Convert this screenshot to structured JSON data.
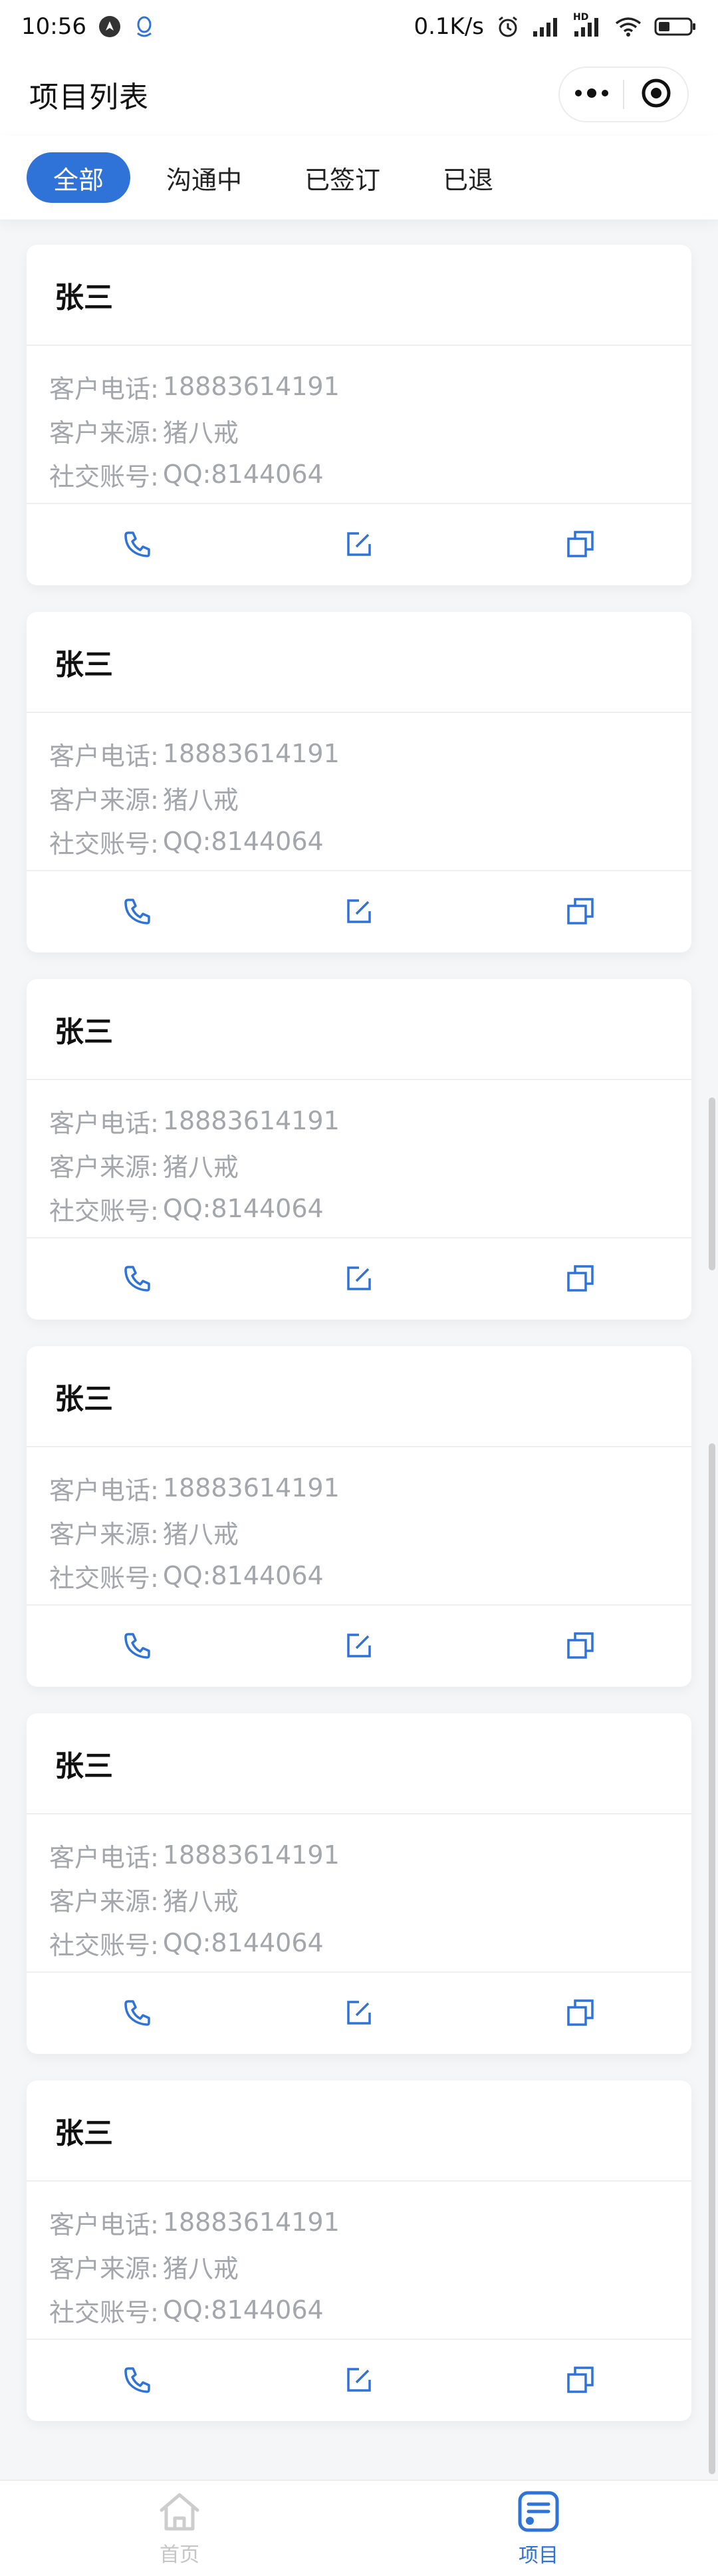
{
  "status_bar": {
    "time": "10:56",
    "net_speed": "0.1K/s",
    "hd_label": "HD",
    "icons": [
      "location-icon",
      "qq-icon",
      "alarm-icon",
      "signal-icon",
      "signal-hd-icon",
      "wifi-icon",
      "battery-icon"
    ]
  },
  "nav": {
    "title": "项目列表",
    "more_icon": "more-dots-icon",
    "close_icon": "target-circle-icon"
  },
  "tabs": [
    {
      "label": "全部",
      "active": true
    },
    {
      "label": "沟通中",
      "active": false
    },
    {
      "label": "已签订",
      "active": false
    },
    {
      "label": "已退",
      "active": false
    }
  ],
  "cards": [
    {
      "name": "张三",
      "phone_label": "客户电话:",
      "phone": "18883614191",
      "source_label": "客户来源:",
      "source": "猪八戒",
      "social_label": "社交账号:",
      "social": "QQ:8144064"
    },
    {
      "name": "张三",
      "phone_label": "客户电话:",
      "phone": "18883614191",
      "source_label": "客户来源:",
      "source": "猪八戒",
      "social_label": "社交账号:",
      "social": "QQ:8144064"
    },
    {
      "name": "张三",
      "phone_label": "客户电话:",
      "phone": "18883614191",
      "source_label": "客户来源:",
      "source": "猪八戒",
      "social_label": "社交账号:",
      "social": "QQ:8144064"
    },
    {
      "name": "张三",
      "phone_label": "客户电话:",
      "phone": "18883614191",
      "source_label": "客户来源:",
      "source": "猪八戒",
      "social_label": "社交账号:",
      "social": "QQ:8144064"
    },
    {
      "name": "张三",
      "phone_label": "客户电话:",
      "phone": "18883614191",
      "source_label": "客户来源:",
      "source": "猪八戒",
      "social_label": "社交账号:",
      "social": "QQ:8144064"
    },
    {
      "name": "张三",
      "phone_label": "客户电话:",
      "phone": "18883614191",
      "source_label": "客户来源:",
      "source": "猪八戒",
      "social_label": "社交账号:",
      "social": "QQ:8144064"
    }
  ],
  "card_actions": [
    "phone-icon",
    "edit-icon",
    "copy-icon"
  ],
  "tabbar": [
    {
      "label": "首页",
      "icon": "home-icon",
      "active": false
    },
    {
      "label": "项目",
      "icon": "project-list-icon",
      "active": true
    }
  ],
  "colors": {
    "accent": "#2f72d8",
    "muted_text": "#a3a6ab",
    "background": "#f5f6f8"
  }
}
